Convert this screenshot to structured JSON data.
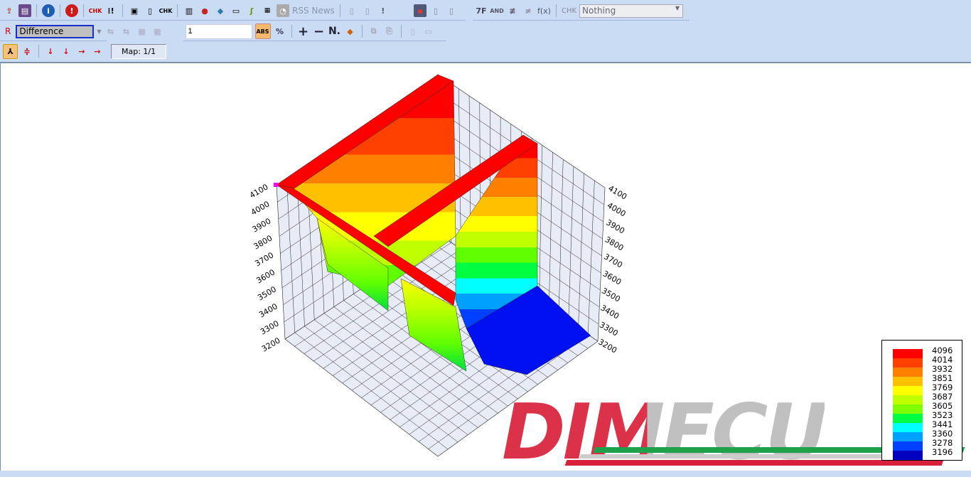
{
  "toolbar1": {
    "icons": [
      "open-icon",
      "save-project-icon",
      "info-icon",
      "alert-icon",
      "checksum-icon",
      "check-icon",
      "window-icon",
      "preview-icon",
      "chk-search-icon",
      "book-icon",
      "globe-icon",
      "network-icon",
      "monitor-icon",
      "plug-icon",
      "chip-icon"
    ],
    "rss_label": "RSS News",
    "chk_label": "CHK",
    "fx_label": "f(x)",
    "hex_label": "7F",
    "dropdown_value": "Nothing"
  },
  "toolbar2": {
    "r_label": "R",
    "map_select": "Difference",
    "value_input": "1",
    "abs_label": "ABS",
    "n_label": "N."
  },
  "toolbar3": {
    "map_label": "Map: 1/1"
  },
  "chart_data": {
    "type": "surface3d",
    "z_ticks": [
      "4100",
      "4000",
      "3900",
      "3800",
      "3700",
      "3600",
      "3500",
      "3400",
      "3300",
      "3200"
    ],
    "zlim": [
      3200,
      4100
    ],
    "legend": {
      "values": [
        "4096",
        "4014",
        "3932",
        "3851",
        "3769",
        "3687",
        "3605",
        "3523",
        "3441",
        "3360",
        "3278",
        "3196"
      ],
      "colors": [
        "#ff0000",
        "#ff4000",
        "#ff8000",
        "#ffc000",
        "#ffff00",
        "#c0ff00",
        "#80ff00",
        "#00ff40",
        "#00ffff",
        "#00a0ff",
        "#0040ff",
        "#0000c0"
      ],
      "placement": "bottom-right"
    }
  },
  "watermark": {
    "logo": "DIMECU"
  }
}
